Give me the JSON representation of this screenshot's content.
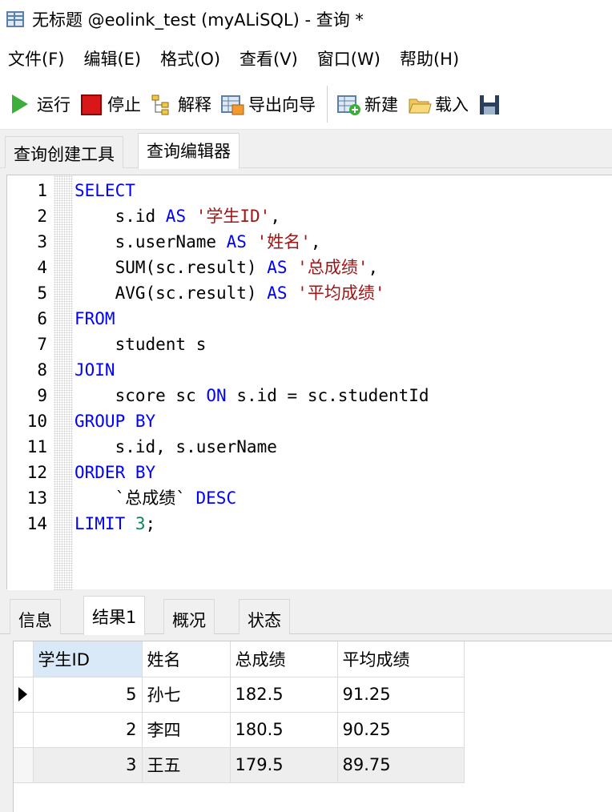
{
  "window": {
    "title": "无标题 @eolink_test (myALiSQL) - 查询 *"
  },
  "menu": [
    "文件(F)",
    "编辑(E)",
    "格式(O)",
    "查看(V)",
    "窗口(W)",
    "帮助(H)"
  ],
  "toolbar": {
    "run": "运行",
    "stop": "停止",
    "explain": "解释",
    "export": "导出向导",
    "new": "新建",
    "load": "载入"
  },
  "tabs": [
    "查询创建工具",
    "查询编辑器"
  ],
  "editor": {
    "lines": [
      [
        "1",
        "SELECT"
      ],
      [
        "2",
        "    s.id AS '学生ID',"
      ],
      [
        "3",
        "    s.userName AS '姓名',"
      ],
      [
        "4",
        "    SUM(sc.result) AS '总成绩',"
      ],
      [
        "5",
        "    AVG(sc.result) AS '平均成绩'"
      ],
      [
        "6",
        "FROM"
      ],
      [
        "7",
        "    student s"
      ],
      [
        "8",
        "JOIN"
      ],
      [
        "9",
        "    score sc ON s.id = sc.studentId"
      ],
      [
        "10",
        "GROUP BY"
      ],
      [
        "11",
        "    s.id, s.userName"
      ],
      [
        "12",
        "ORDER BY"
      ],
      [
        "13",
        "    `总成绩` DESC"
      ],
      [
        "14",
        "LIMIT 3;"
      ]
    ]
  },
  "result_tabs": [
    "信息",
    "结果1",
    "概况",
    "状态"
  ],
  "result": {
    "columns": [
      "学生ID",
      "姓名",
      "总成绩",
      "平均成绩"
    ],
    "rows": [
      [
        "5",
        "孙七",
        "182.5",
        "91.25"
      ],
      [
        "2",
        "李四",
        "180.5",
        "90.25"
      ],
      [
        "3",
        "王五",
        "179.5",
        "89.75"
      ]
    ]
  }
}
